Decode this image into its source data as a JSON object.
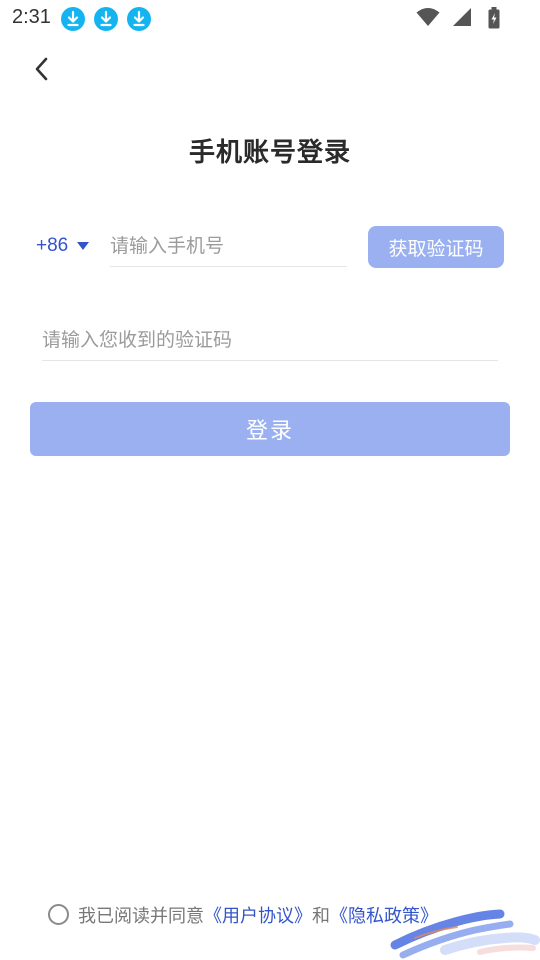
{
  "status_bar": {
    "time": "2:31",
    "notification_icons": [
      "download-icon",
      "download-icon",
      "download-icon"
    ],
    "right_icons": [
      "wifi-icon",
      "signal-icon",
      "battery-icon"
    ]
  },
  "nav": {
    "back_icon": "chevron-left-icon"
  },
  "page": {
    "title": "手机账号登录"
  },
  "form": {
    "country_code": "+86",
    "phone_placeholder": "请输入手机号",
    "phone_value": "",
    "get_code_label": "获取验证码",
    "code_placeholder": "请输入您收到的验证码",
    "code_value": "",
    "login_label": "登录"
  },
  "agreement": {
    "prefix": "我已阅读并同意",
    "user_agreement": "《用户协议》",
    "conjunction": "和",
    "privacy_policy": "《隐私政策》",
    "checked": false
  },
  "colors": {
    "accent": "#3355cc",
    "button_disabled": "#9ab0f0",
    "download_badge": "#14b4f0"
  }
}
